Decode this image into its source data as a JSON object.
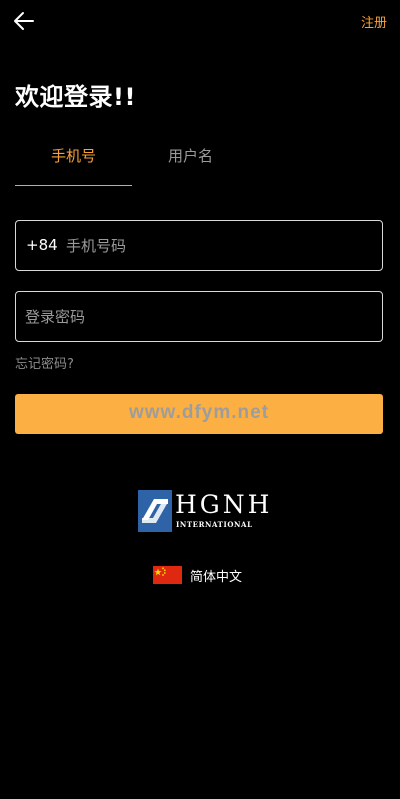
{
  "header": {
    "back_icon": "arrow-left-icon",
    "register_label": "注册",
    "accent_color": "#f7a13a"
  },
  "welcome_title": "欢迎登录!!",
  "tabs": [
    {
      "label": "手机号",
      "active": true
    },
    {
      "label": "用户名",
      "active": false
    }
  ],
  "phone_field": {
    "country_code": "+84",
    "placeholder": "手机号码",
    "value": ""
  },
  "password_field": {
    "placeholder": "登录密码",
    "value": ""
  },
  "forgot_password_label": "忘记密码?",
  "login_button": {
    "color": "#fcaf42",
    "watermark": "www.dfym.net"
  },
  "logo": {
    "title": "HGNH",
    "subtitle": "INTERNATIONAL",
    "mark_color": "#2f63a8"
  },
  "language": {
    "flag_icon": "china-flag-icon",
    "label": "简体中文"
  }
}
